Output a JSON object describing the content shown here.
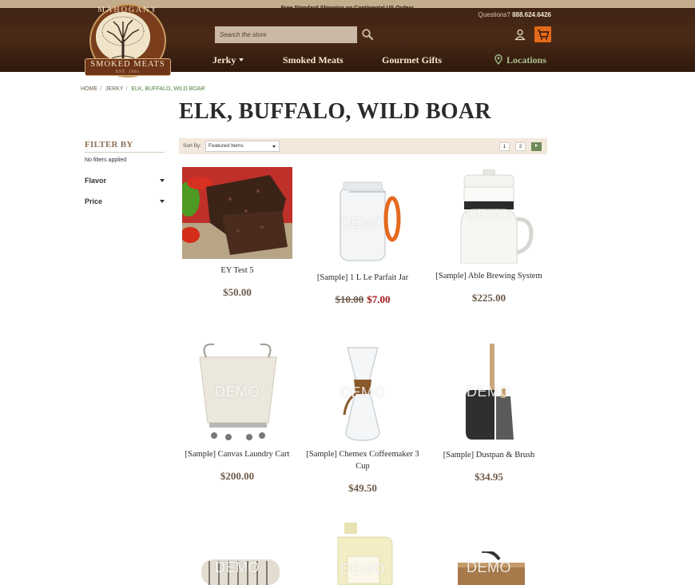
{
  "banner": {
    "text": "Free Standard Shipping on Continental US Orders"
  },
  "logo": {
    "top_text": "MAHOGANY",
    "name": "SMOKED MEATS",
    "est": "EST. 1961"
  },
  "search": {
    "placeholder": "Search the store"
  },
  "contact": {
    "label": "Questions?",
    "phone": "888.624.6426"
  },
  "nav": {
    "jerky": "Jerky",
    "smoked_meats": "Smoked Meats",
    "gourmet_gifts": "Gourmet Gifts",
    "locations": "Locations"
  },
  "breadcrumb": [
    "HOME",
    "JERKY",
    "ELK, BUFFALO, WILD BOAR"
  ],
  "page": {
    "title": "ELK, BUFFALO, WILD BOAR"
  },
  "sidebar": {
    "heading": "FILTER BY",
    "note": "No filters applied",
    "facets": [
      "Flavor",
      "Price"
    ]
  },
  "sort": {
    "label": "Sort By:",
    "selected": "Featured Items"
  },
  "pagination": {
    "pages": [
      "1",
      "2"
    ]
  },
  "demo_label": "DEMO",
  "products": [
    {
      "name": "EY Test 5",
      "price": "$50.00"
    },
    {
      "name": "[Sample] 1 L Le Parfait Jar",
      "old_price": "$10.00",
      "sale_price": "$7.00"
    },
    {
      "name": "[Sample] Able Brewing System",
      "price": "$225.00"
    },
    {
      "name": "[Sample] Canvas Laundry Cart",
      "price": "$200.00"
    },
    {
      "name": "[Sample] Chemex Coffeemaker 3 Cup",
      "price": "$49.50"
    },
    {
      "name": "[Sample] Dustpan & Brush",
      "price": "$34.95"
    },
    {
      "name": "",
      "price": ""
    },
    {
      "name": "",
      "price": ""
    },
    {
      "name": "",
      "price": ""
    }
  ],
  "colors": {
    "header_brown": "#4b2a17",
    "cart_orange": "#e36a1b",
    "sale_red": "#a31818",
    "locations_green": "#a7c08f"
  },
  "icons": [
    "search-icon",
    "account-icon",
    "cart-icon",
    "location-pin-icon"
  ]
}
